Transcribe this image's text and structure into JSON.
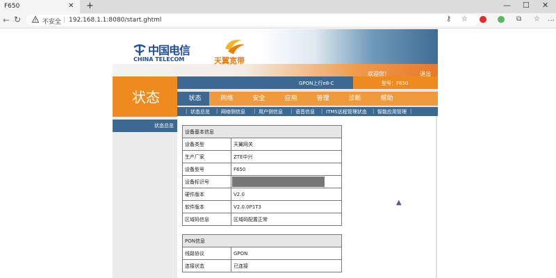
{
  "browser": {
    "tab_title": "F650",
    "tab_close": "✕",
    "new_tab": "+",
    "win_min": "—",
    "win_max": "☐",
    "win_close": "✕",
    "back": "←",
    "reload": "↻",
    "insecure_label": "不安全",
    "separator": "|",
    "url": "192.168.1.1:8080/start.ghtml",
    "key_icon": "⚷",
    "star_icon": "☆",
    "fav_icon": "☆",
    "menu_icon": "…",
    "collections_icon": "⧉",
    "profile_icon": "⬡"
  },
  "banner": {
    "logo_cn": "中国电信",
    "logo_en": "CHINA TELECOM",
    "logo2_text": "天翼宽带",
    "welcome": "欢迎您！",
    "logout": "退出"
  },
  "header": {
    "page_title": "状态",
    "model_line": "GPON上行e8-C",
    "model_number": "型号：F650"
  },
  "menu": {
    "tabs": [
      "状态",
      "网络",
      "安全",
      "应用",
      "管理",
      "诊断",
      "帮助"
    ],
    "active": 0
  },
  "submenu": {
    "items": [
      "状态总览",
      "网络侧信息",
      "用户侧信息",
      "语音信息",
      "ITMS远程管理状态",
      "智能应用管理"
    ]
  },
  "left_nav": {
    "item": "状态总览"
  },
  "device_info": {
    "heading": "设备基本信息",
    "rows": [
      {
        "key": "设备类型",
        "value": "天翼网关"
      },
      {
        "key": "生产厂家",
        "value": "ZTE中兴"
      },
      {
        "key": "设备型号",
        "value": "F650"
      },
      {
        "key": "设备标识号",
        "value": ""
      },
      {
        "key": "硬件版本",
        "value": "V2.0"
      },
      {
        "key": "软件版本",
        "value": "V2.0.0P1T3"
      },
      {
        "key": "区域码信息",
        "value": "区域码配置正常"
      }
    ]
  },
  "pon_info": {
    "heading": "PON信息",
    "rows": [
      {
        "key": "线路协议",
        "value": "GPON"
      },
      {
        "key": "连接状态",
        "value": "已连接"
      }
    ]
  },
  "colors": {
    "orange": "#ef8a1e",
    "blue": "#3b6991",
    "telecom_blue": "#1f4e96"
  }
}
